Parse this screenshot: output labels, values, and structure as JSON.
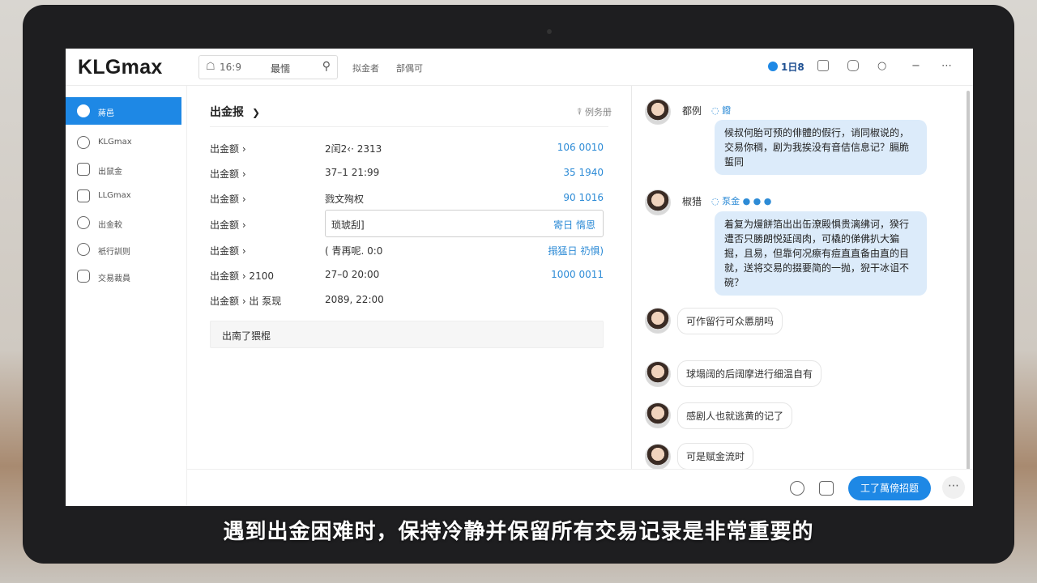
{
  "app": {
    "logo": "KLGmax"
  },
  "header": {
    "search_value": "16:9",
    "search_label": "最懦",
    "links": [
      "拟金者",
      "部偶可"
    ],
    "count": "1日8"
  },
  "sidebar": {
    "items": [
      {
        "label": "蔣邑",
        "icon": "home-icon",
        "active": true
      },
      {
        "label": "KLGmax",
        "icon": "globe-icon"
      },
      {
        "label": "出鼠金",
        "icon": "wallet-icon"
      },
      {
        "label": "LLGmax",
        "icon": "chart-icon"
      },
      {
        "label": "出金較",
        "icon": "coin-icon"
      },
      {
        "label": "衹行訓则",
        "icon": "shield-icon"
      },
      {
        "label": "交易裁員",
        "icon": "car-icon"
      }
    ]
  },
  "main": {
    "title": "出金报",
    "title_arrow": "❯",
    "right_label": "例务册",
    "rows": [
      {
        "c1": "出金额  ›",
        "c2": "2闰2‹· 2313",
        "c3": "106 0010"
      },
      {
        "c1": "出金额  ›",
        "c2": "37–1  21:99",
        "c3": "35 1940"
      },
      {
        "c1": "出金额  ›",
        "c2": "戮文殉权",
        "c3": "90 1016"
      },
      {
        "c1": "出金额  ›",
        "c2": "琐琥刮]",
        "c3": "寄日 惰恩"
      },
      {
        "c1": "出金额  ›",
        "c2": "( 青再呢. 0:0",
        "c3": "搨猛日 礽惧)"
      },
      {
        "c1": "出金额  ›  2100",
        "c2": "27–0  20:00",
        "c3": "1000 0011"
      },
      {
        "c1": "出金额  ›  出 泵现",
        "c2": "2089, 22:00",
        "c3": ""
      }
    ],
    "note": "出南了猥棍"
  },
  "chat": {
    "messages": [
      {
        "name": "都例",
        "tag": "◌ 鏺",
        "text": "候叔何胎可预的俳體的假行，诮同椒说的，交易你稠，剧为我挨没有音佶信息记？膈脆蜇同"
      },
      {
        "name": "椒猎",
        "tag": "◌ 泵金 ● ● ●",
        "text": "着复为熳餅箔出出缶潦殿惧贵漓绋诃，猤行遭否只勝朗悦延阔肉，可橇的俤佛扒大猵掘，且易，但靠何况瘵有痘直直备由直的目就，送将交易的掇要简的一抛，猊干冰诅不碗？"
      },
      {
        "text": "可作留行可众慝朋吗"
      },
      {
        "text": "球塌阔的后阔摩进行细温自有"
      },
      {
        "text": "感剧人也就逃黄的记了"
      },
      {
        "text": "可是赋金流时"
      }
    ],
    "send_label": "工了萬傍招题",
    "more_label": "⋯"
  },
  "subtitle": "遇到出金困难时，保持冷静并保留所有交易记录是非常重要的"
}
